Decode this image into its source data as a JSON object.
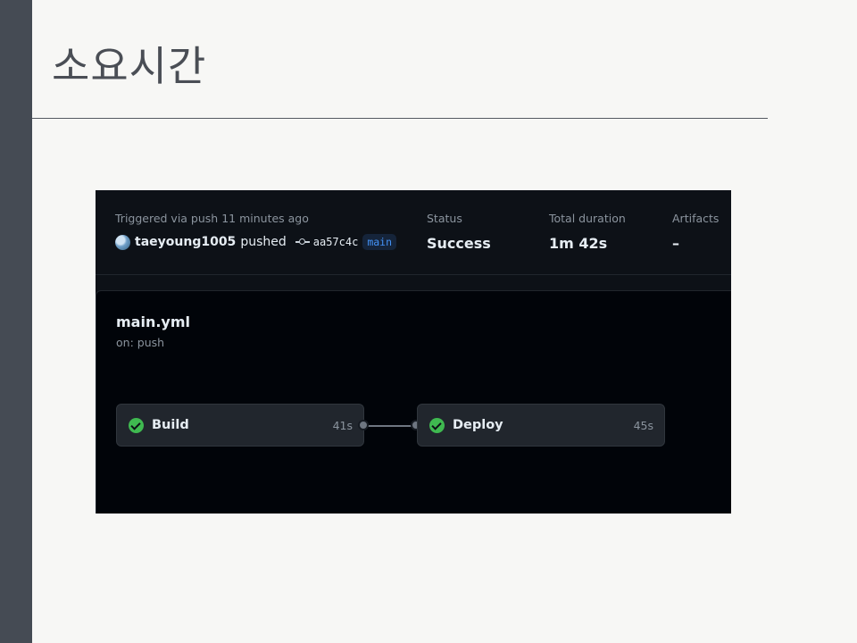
{
  "slide": {
    "title": "소요시간"
  },
  "run_summary": {
    "trigger_label": "Triggered via push 11 minutes ago",
    "user": "taeyoung1005",
    "action": "pushed",
    "commit_sha": "aa57c4c",
    "branch": "main",
    "status_label": "Status",
    "status_value": "Success",
    "duration_label": "Total duration",
    "duration_value": "1m 42s",
    "artifacts_label": "Artifacts",
    "artifacts_value": "–"
  },
  "workflow": {
    "file": "main.yml",
    "trigger": "on: push",
    "jobs": [
      {
        "name": "Build",
        "time": "41s",
        "status": "success"
      },
      {
        "name": "Deploy",
        "time": "45s",
        "status": "success"
      }
    ]
  },
  "colors": {
    "accent_success": "#3fb950",
    "branch_blue": "#4493f8",
    "panel_bg": "#0d1117"
  }
}
